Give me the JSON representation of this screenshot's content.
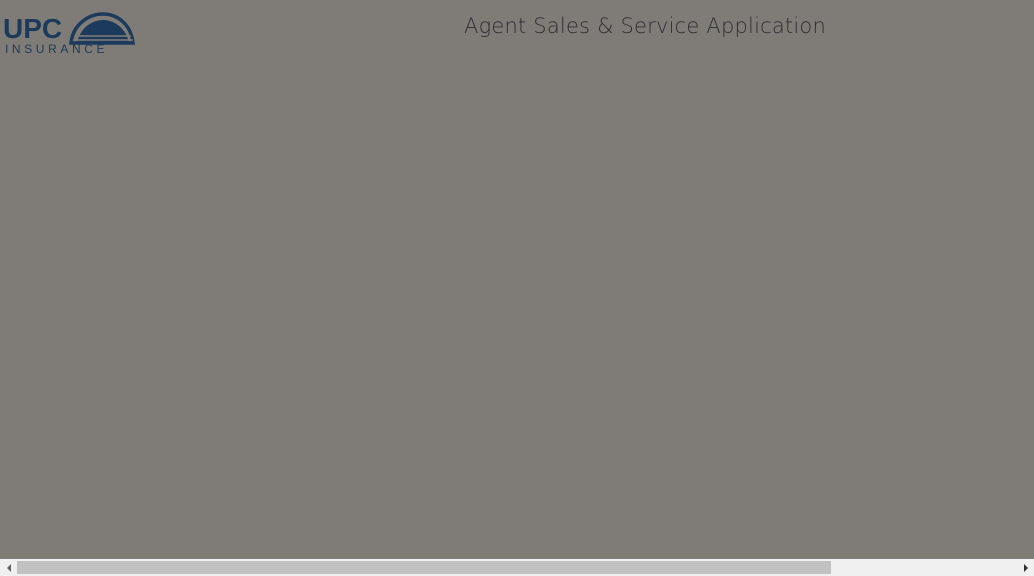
{
  "header": {
    "logo": {
      "brand_top": "UPC",
      "brand_bottom": "INSURANCE",
      "color": "#1b3a5c"
    },
    "app_title": "Agent Sales & Service Application"
  },
  "scrollbar": {
    "orientation": "horizontal",
    "left_icon": "scroll-left-arrow",
    "right_icon": "scroll-right-arrow",
    "thumb_fraction": 0.8
  }
}
